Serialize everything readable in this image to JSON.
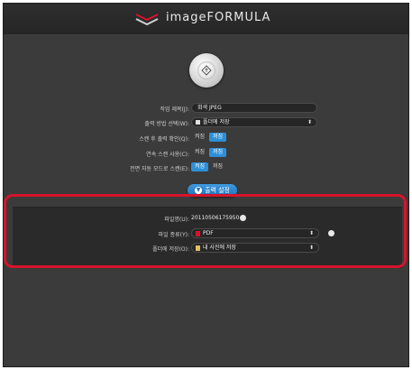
{
  "header": {
    "logo_text": "imageFORMULA"
  },
  "form": {
    "job_title": {
      "label": "작업 제목(J):",
      "value": "회색 JPEG"
    },
    "output_method": {
      "label": "출력 방법 선택(W):",
      "value": "폴더에 저장"
    },
    "confirm_after_scan": {
      "label": "스캔 후 출력 확인(Q):",
      "on": "켜짐",
      "off": "꺼짐"
    },
    "continuous_scan": {
      "label": "연속 스캔 사용(C):",
      "on": "켜짐",
      "off": "꺼짐"
    },
    "auto_feed": {
      "label": "전면 자동 모드로 스캔(E):",
      "on": "켜짐",
      "off": "꺼짐"
    }
  },
  "output_settings_button": "출력 설정",
  "output_panel": {
    "file_name": {
      "label": "파일명(U):",
      "value": "20110506175950"
    },
    "file_type": {
      "label": "파일 종류(Y):",
      "value": "PDF"
    },
    "save_to_folder": {
      "label": "폴더에 저장(O):",
      "value": "내 사진에 저장"
    }
  },
  "colors": {
    "accent": "#2d8fd6",
    "highlight": "#d6142b",
    "background": "#3b3b3b"
  }
}
